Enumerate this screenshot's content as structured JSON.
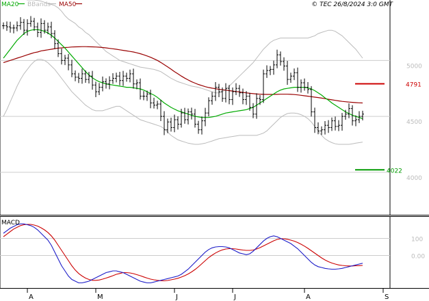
{
  "legend": {
    "ma20": "MA20",
    "bbands": "BBands",
    "ma50": "MA50"
  },
  "header": {
    "source": "© TEC 26/8/2024 3:0 GMT"
  },
  "colors": {
    "price": "#000000",
    "ma20": "#00aa00",
    "ma50": "#990000",
    "bbands": "#bbbbbb",
    "macd": "#1c1cc8",
    "signal": "#cc0000",
    "resistance": "#cc0000",
    "support": "#009900",
    "grid": "#cccccc"
  },
  "chart_data": [
    {
      "type": "line",
      "title": "",
      "levels": {
        "resistance": {
          "value": 4791,
          "label": "4791"
        },
        "support": {
          "value": 4022,
          "label": "4022"
        }
      },
      "y_ticks": [
        {
          "value": 4000,
          "label": "4000"
        },
        {
          "value": 4500,
          "label": "4500"
        },
        {
          "value": 5000,
          "label": "5000"
        }
      ],
      "x_ticks": [
        {
          "day": 7,
          "label": "A"
        },
        {
          "day": 27,
          "label": "M"
        },
        {
          "day": 50,
          "label": "J"
        },
        {
          "day": 67,
          "label": "J"
        },
        {
          "day": 88,
          "label": "A"
        },
        {
          "day": 111,
          "label": "S"
        }
      ],
      "ylim": [
        3620,
        5540
      ],
      "xlim": [
        -1,
        113
      ],
      "close": [
        5310,
        5300,
        5290,
        5290,
        5310,
        5340,
        5270,
        5330,
        5350,
        5300,
        5250,
        5330,
        5270,
        5300,
        5240,
        5150,
        5060,
        5000,
        5020,
        4960,
        4880,
        4850,
        4840,
        4880,
        4830,
        4860,
        4780,
        4720,
        4760,
        4810,
        4790,
        4820,
        4840,
        4860,
        4820,
        4860,
        4840,
        4880,
        4790,
        4800,
        4680,
        4680,
        4700,
        4620,
        4600,
        4610,
        4500,
        4380,
        4450,
        4400,
        4470,
        4430,
        4530,
        4470,
        4540,
        4520,
        4430,
        4380,
        4460,
        4530,
        4640,
        4680,
        4760,
        4720,
        4660,
        4750,
        4650,
        4720,
        4750,
        4710,
        4650,
        4680,
        4580,
        4520,
        4660,
        4650,
        4880,
        4910,
        4920,
        4960,
        5050,
        4990,
        4950,
        4830,
        4860,
        4890,
        4760,
        4800,
        4760,
        4740,
        4540,
        4400,
        4370,
        4380,
        4420,
        4400,
        4460,
        4410,
        4420,
        4500,
        4520,
        4570,
        4460,
        4470,
        4500,
        4520
      ],
      "ma20": [
        5020,
        5060,
        5100,
        5140,
        5180,
        5210,
        5240,
        5260,
        5270,
        5275,
        5275,
        5270,
        5260,
        5245,
        5225,
        5200,
        5170,
        5140,
        5110,
        5075,
        5040,
        5005,
        4970,
        4935,
        4900,
        4870,
        4845,
        4825,
        4810,
        4800,
        4790,
        4785,
        4780,
        4775,
        4770,
        4765,
        4760,
        4760,
        4755,
        4750,
        4745,
        4735,
        4720,
        4705,
        4690,
        4670,
        4645,
        4620,
        4600,
        4580,
        4565,
        4550,
        4540,
        4530,
        4520,
        4510,
        4500,
        4495,
        4490,
        4490,
        4490,
        4495,
        4500,
        4510,
        4520,
        4530,
        4535,
        4540,
        4545,
        4550,
        4555,
        4560,
        4570,
        4580,
        4600,
        4620,
        4640,
        4660,
        4680,
        4700,
        4720,
        4735,
        4745,
        4750,
        4755,
        4760,
        4760,
        4760,
        4760,
        4755,
        4745,
        4730,
        4710,
        4690,
        4665,
        4645,
        4620,
        4600,
        4580,
        4560,
        4540,
        4525,
        4510,
        4500,
        4490,
        4480
      ],
      "ma50": [
        4980,
        4990,
        5000,
        5010,
        5020,
        5030,
        5040,
        5050,
        5060,
        5070,
        5075,
        5085,
        5090,
        5095,
        5100,
        5105,
        5110,
        5112,
        5115,
        5117,
        5120,
        5121,
        5122,
        5123,
        5123,
        5122,
        5121,
        5120,
        5118,
        5115,
        5112,
        5108,
        5104,
        5100,
        5095,
        5090,
        5085,
        5080,
        5075,
        5068,
        5060,
        5050,
        5040,
        5028,
        5015,
        5000,
        4982,
        4962,
        4942,
        4922,
        4900,
        4880,
        4860,
        4842,
        4825,
        4810,
        4797,
        4785,
        4775,
        4765,
        4758,
        4752,
        4747,
        4742,
        4738,
        4734,
        4730,
        4726,
        4722,
        4718,
        4714,
        4710,
        4706,
        4703,
        4700,
        4698,
        4697,
        4696,
        4696,
        4696,
        4697,
        4698,
        4698,
        4698,
        4697,
        4695,
        4692,
        4688,
        4684,
        4680,
        4676,
        4672,
        4668,
        4663,
        4658,
        4653,
        4648,
        4643,
        4638,
        4634,
        4631,
        4628,
        4625,
        4623,
        4621,
        4620
      ],
      "bb_upper": [
        5540,
        5550,
        5560,
        5560,
        5560,
        5555,
        5550,
        5540,
        5540,
        5540,
        5535,
        5530,
        5520,
        5510,
        5500,
        5490,
        5470,
        5440,
        5400,
        5370,
        5350,
        5330,
        5300,
        5280,
        5250,
        5230,
        5200,
        5170,
        5140,
        5110,
        5080,
        5060,
        5040,
        5020,
        5000,
        4990,
        4980,
        4970,
        4960,
        4950,
        4940,
        4935,
        4930,
        4925,
        4920,
        4910,
        4900,
        4880,
        4860,
        4840,
        4825,
        4810,
        4800,
        4790,
        4780,
        4770,
        4765,
        4760,
        4750,
        4740,
        4730,
        4720,
        4710,
        4710,
        4720,
        4740,
        4770,
        4800,
        4830,
        4860,
        4890,
        4920,
        4950,
        4980,
        5020,
        5060,
        5100,
        5130,
        5160,
        5180,
        5190,
        5200,
        5200,
        5200,
        5200,
        5200,
        5200,
        5200,
        5200,
        5200,
        5210,
        5220,
        5240,
        5250,
        5260,
        5270,
        5270,
        5260,
        5240,
        5220,
        5190,
        5160,
        5130,
        5100,
        5060,
        5020
      ],
      "bb_lower": [
        4500,
        4560,
        4630,
        4700,
        4770,
        4830,
        4880,
        4920,
        4960,
        4990,
        5010,
        5010,
        5000,
        4980,
        4950,
        4920,
        4880,
        4840,
        4800,
        4760,
        4720,
        4690,
        4660,
        4630,
        4600,
        4580,
        4560,
        4550,
        4550,
        4550,
        4560,
        4570,
        4580,
        4590,
        4590,
        4570,
        4550,
        4530,
        4510,
        4490,
        4470,
        4460,
        4450,
        4440,
        4430,
        4420,
        4410,
        4390,
        4360,
        4330,
        4310,
        4290,
        4280,
        4270,
        4260,
        4255,
        4250,
        4250,
        4255,
        4260,
        4270,
        4280,
        4290,
        4300,
        4305,
        4310,
        4315,
        4320,
        4325,
        4330,
        4330,
        4330,
        4330,
        4330,
        4330,
        4340,
        4350,
        4370,
        4400,
        4430,
        4460,
        4490,
        4510,
        4525,
        4530,
        4530,
        4525,
        4515,
        4500,
        4480,
        4450,
        4410,
        4370,
        4330,
        4300,
        4280,
        4265,
        4255,
        4250,
        4250,
        4250,
        4250,
        4255,
        4260,
        4265,
        4270
      ]
    },
    {
      "type": "line",
      "title": "MACD",
      "y_ticks": [
        {
          "value": 100,
          "label": "100"
        },
        {
          "value": 0,
          "label": "0.00"
        }
      ],
      "ylim": [
        -190,
        230
      ],
      "macd": [
        130,
        145,
        160,
        170,
        180,
        185,
        185,
        180,
        175,
        165,
        150,
        130,
        110,
        90,
        60,
        20,
        -20,
        -60,
        -90,
        -120,
        -140,
        -150,
        -160,
        -160,
        -155,
        -150,
        -140,
        -130,
        -120,
        -110,
        -100,
        -95,
        -90,
        -90,
        -95,
        -100,
        -110,
        -120,
        -130,
        -140,
        -150,
        -155,
        -160,
        -160,
        -155,
        -150,
        -145,
        -140,
        -135,
        -130,
        -125,
        -120,
        -110,
        -95,
        -80,
        -60,
        -40,
        -20,
        0,
        20,
        35,
        45,
        50,
        52,
        52,
        50,
        45,
        35,
        25,
        15,
        10,
        5,
        10,
        25,
        45,
        65,
        85,
        100,
        110,
        115,
        110,
        100,
        90,
        80,
        70,
        55,
        40,
        20,
        0,
        -20,
        -40,
        -55,
        -65,
        -70,
        -75,
        -78,
        -80,
        -80,
        -78,
        -75,
        -70,
        -65,
        -60,
        -55,
        -50,
        -45
      ],
      "signal": [
        110,
        125,
        140,
        155,
        165,
        175,
        180,
        182,
        182,
        178,
        172,
        162,
        150,
        135,
        115,
        90,
        60,
        30,
        0,
        -30,
        -60,
        -85,
        -105,
        -120,
        -132,
        -140,
        -145,
        -145,
        -143,
        -138,
        -132,
        -125,
        -118,
        -110,
        -105,
        -100,
        -100,
        -102,
        -106,
        -112,
        -118,
        -125,
        -132,
        -138,
        -142,
        -145,
        -147,
        -148,
        -146,
        -142,
        -138,
        -133,
        -126,
        -118,
        -108,
        -96,
        -82,
        -66,
        -48,
        -30,
        -12,
        2,
        15,
        25,
        33,
        38,
        40,
        40,
        38,
        35,
        32,
        30,
        30,
        32,
        38,
        46,
        56,
        66,
        76,
        86,
        94,
        98,
        98,
        95,
        90,
        84,
        76,
        66,
        55,
        42,
        28,
        14,
        0,
        -14,
        -26,
        -36,
        -44,
        -50,
        -55,
        -58,
        -60,
        -61,
        -61,
        -60,
        -59,
        -58
      ],
      "ylabel": ""
    }
  ]
}
